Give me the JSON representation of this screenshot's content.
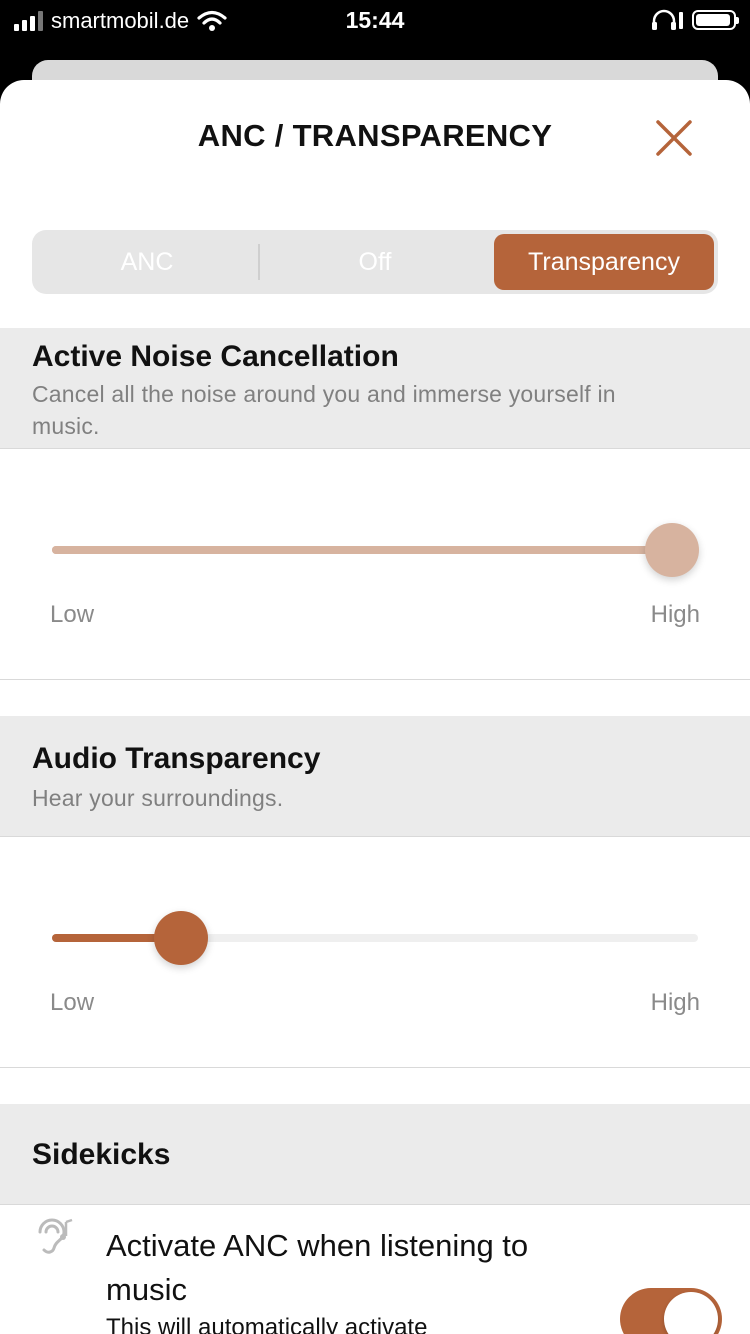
{
  "status_bar": {
    "carrier": "smartmobil.de",
    "time": "15:44"
  },
  "sheet": {
    "title": "ANC / TRANSPARENCY"
  },
  "mode_selector": {
    "options": [
      "ANC",
      "Off",
      "Transparency"
    ],
    "selected": "Transparency"
  },
  "anc": {
    "title": "Active Noise Cancellation",
    "description": "Cancel all the noise around you and immerse yourself in music.",
    "slider_value": 1.0,
    "low_label": "Low",
    "high_label": "High"
  },
  "transparency": {
    "title": "Audio Transparency",
    "description": "Hear your surroundings.",
    "slider_value": 0.2,
    "low_label": "Low",
    "high_label": "High"
  },
  "sidekicks": {
    "title": "Sidekicks",
    "item_title": "Activate ANC when listening to music",
    "item_subtitle": "This will automatically activate",
    "toggle_on": true
  },
  "colors": {
    "accent": "#b5643a",
    "accent_light": "#d7b39f",
    "section_bg": "#ebebeb",
    "track_bg": "#efefef"
  },
  "icons": {
    "close": "close-icon",
    "sidekick": "ear-music-icon"
  }
}
